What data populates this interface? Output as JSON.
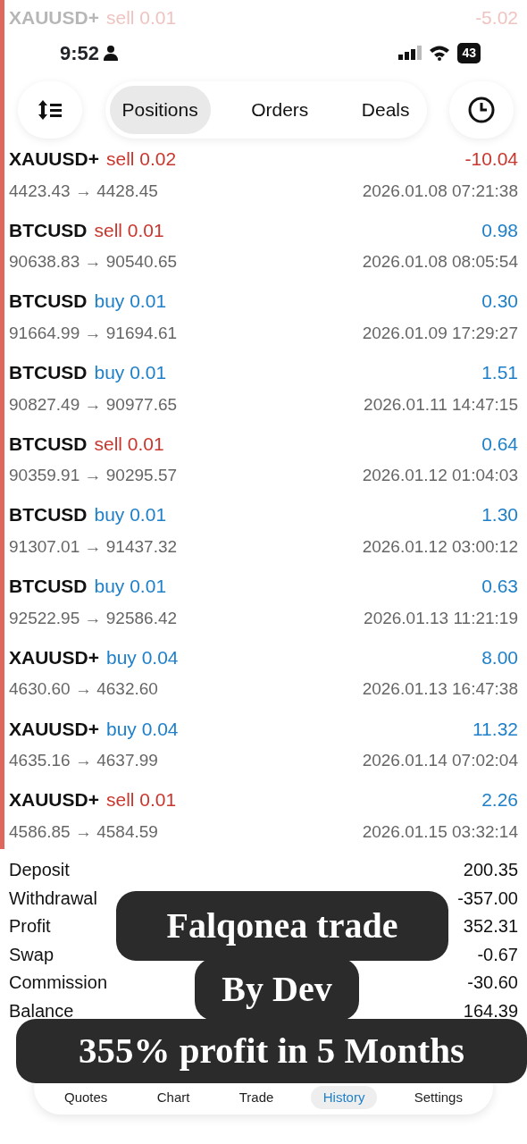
{
  "faded_row": {
    "symbol": "XAUUSD+",
    "side": "sell 0.01",
    "kind": "sell",
    "profit": "-5.02",
    "loss": true
  },
  "status_bar": {
    "time": "9:52",
    "battery": "43"
  },
  "tabs": [
    {
      "label": "Positions",
      "selected": true
    },
    {
      "label": "Orders",
      "selected": false
    },
    {
      "label": "Deals",
      "selected": false
    }
  ],
  "deals": [
    {
      "symbol": "XAUUSD+",
      "side": "sell 0.02",
      "kind": "sell",
      "prices": "4423.43 → 4428.45",
      "time": "2026.01.08 07:21:38",
      "profit": "-10.04",
      "loss": true
    },
    {
      "symbol": "BTCUSD",
      "side": "sell 0.01",
      "kind": "sell",
      "prices": "90638.83 → 90540.65",
      "time": "2026.01.08 08:05:54",
      "profit": "0.98",
      "loss": false
    },
    {
      "symbol": "BTCUSD",
      "side": "buy 0.01",
      "kind": "buy",
      "prices": "91664.99 → 91694.61",
      "time": "2026.01.09 17:29:27",
      "profit": "0.30",
      "loss": false
    },
    {
      "symbol": "BTCUSD",
      "side": "buy 0.01",
      "kind": "buy",
      "prices": "90827.49 → 90977.65",
      "time": "2026.01.11 14:47:15",
      "profit": "1.51",
      "loss": false
    },
    {
      "symbol": "BTCUSD",
      "side": "sell 0.01",
      "kind": "sell",
      "prices": "90359.91 → 90295.57",
      "time": "2026.01.12 01:04:03",
      "profit": "0.64",
      "loss": false
    },
    {
      "symbol": "BTCUSD",
      "side": "buy 0.01",
      "kind": "buy",
      "prices": "91307.01 → 91437.32",
      "time": "2026.01.12 03:00:12",
      "profit": "1.30",
      "loss": false
    },
    {
      "symbol": "BTCUSD",
      "side": "buy 0.01",
      "kind": "buy",
      "prices": "92522.95 → 92586.42",
      "time": "2026.01.13 11:21:19",
      "profit": "0.63",
      "loss": false
    },
    {
      "symbol": "XAUUSD+",
      "side": "buy 0.04",
      "kind": "buy",
      "prices": "4630.60 → 4632.60",
      "time": "2026.01.13 16:47:38",
      "profit": "8.00",
      "loss": false
    },
    {
      "symbol": "XAUUSD+",
      "side": "buy 0.04",
      "kind": "buy",
      "prices": "4635.16 → 4637.99",
      "time": "2026.01.14 07:02:04",
      "profit": "11.32",
      "loss": false
    },
    {
      "symbol": "XAUUSD+",
      "side": "sell 0.01",
      "kind": "sell",
      "prices": "4586.85 → 4584.59",
      "time": "2026.01.15 03:32:14",
      "profit": "2.26",
      "loss": false
    }
  ],
  "summary": [
    {
      "label": "Deposit",
      "value": "200.35"
    },
    {
      "label": "Withdrawal",
      "value": "-357.00"
    },
    {
      "label": "Profit",
      "value": "352.31"
    },
    {
      "label": "Swap",
      "value": "-0.67"
    },
    {
      "label": "Commission",
      "value": "-30.60"
    },
    {
      "label": "Balance",
      "value": "164.39"
    }
  ],
  "bottom_nav": [
    {
      "label": "Quotes",
      "selected": false
    },
    {
      "label": "Chart",
      "selected": false
    },
    {
      "label": "Trade",
      "selected": false
    },
    {
      "label": "History",
      "selected": true
    },
    {
      "label": "Settings",
      "selected": false
    }
  ],
  "caption": [
    "Falqonea trade",
    "By Dev",
    "355% profit in 5 Months"
  ]
}
